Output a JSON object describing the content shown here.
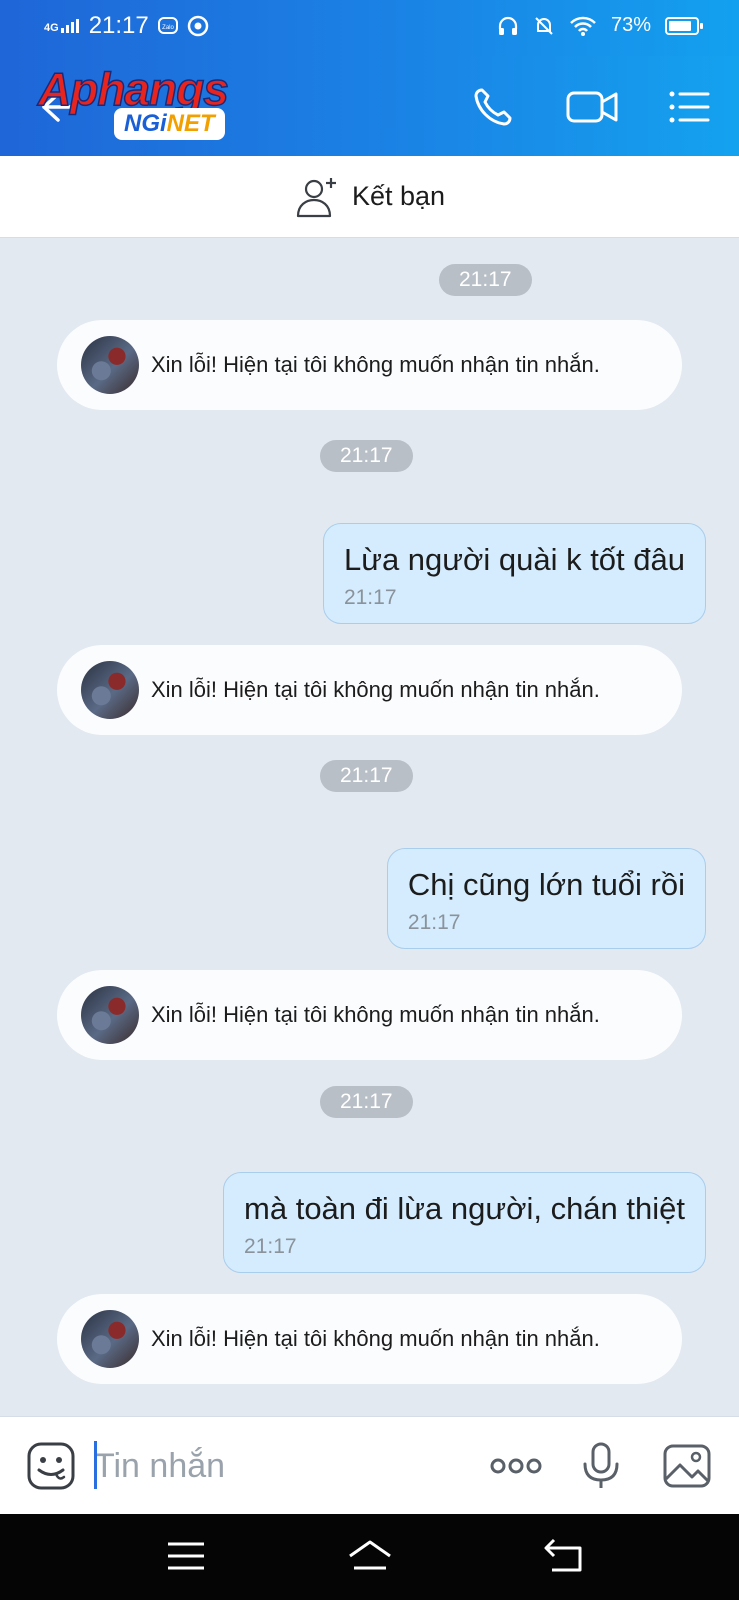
{
  "status_bar": {
    "network": "4G",
    "time": "21:17",
    "battery": "73%"
  },
  "header": {
    "logo_text": "Aphangs",
    "logo_sub_left": "NGi",
    "logo_sub_right": "NET"
  },
  "add_friend": {
    "label": "Kết bạn"
  },
  "messages": [
    {
      "type": "time",
      "text": "21:17"
    },
    {
      "type": "bot",
      "text": "Xin lỗi! Hiện tại tôi không muốn nhận tin nhắn."
    },
    {
      "type": "time",
      "text": "21:17"
    },
    {
      "type": "mine",
      "text": "Lừa người quài k tốt đâu",
      "time": "21:17"
    },
    {
      "type": "bot",
      "text": "Xin lỗi! Hiện tại tôi không muốn nhận tin nhắn."
    },
    {
      "type": "time",
      "text": "21:17"
    },
    {
      "type": "mine",
      "text": "Chị cũng lớn tuổi rồi",
      "time": "21:17"
    },
    {
      "type": "bot",
      "text": "Xin lỗi! Hiện tại tôi không muốn nhận tin nhắn."
    },
    {
      "type": "time",
      "text": "21:17"
    },
    {
      "type": "mine",
      "text": "mà toàn đi lừa người, chán thiệt",
      "time": "21:17"
    },
    {
      "type": "bot",
      "text": "Xin lỗi! Hiện tại tôi không muốn nhận tin nhắn."
    }
  ],
  "input": {
    "placeholder": "Tin nhắn",
    "value": ""
  },
  "icons": {
    "back": "back-arrow-icon",
    "call": "phone-icon",
    "video": "video-camera-icon",
    "menu": "list-menu-icon",
    "add_friend": "add-person-icon",
    "emoji": "emoji-icon",
    "more": "more-dots-icon",
    "mic": "microphone-icon",
    "image": "image-icon"
  },
  "colors": {
    "header": "#1a86e6",
    "my_bubble": "#d4ecfd",
    "chat_bg": "#e2e9f1"
  }
}
